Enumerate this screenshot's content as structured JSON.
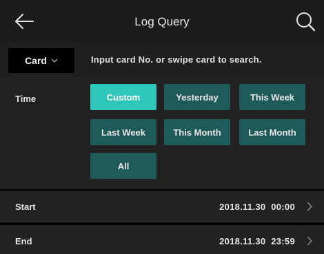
{
  "header": {
    "title": "Log Query",
    "back_icon": "arrow-left-icon",
    "search_icon": "search-icon"
  },
  "search": {
    "type_selected": "Card",
    "hint": "Input card No. or swipe card to search."
  },
  "time": {
    "label": "Time",
    "options": [
      "Custom",
      "Yesterday",
      "This Week",
      "Last Week",
      "This Month",
      "Last Month",
      "All"
    ],
    "selected": "Custom",
    "accent_color": "#2ec7bb",
    "button_color": "#1e5a58"
  },
  "start": {
    "label": "Start",
    "value": "2018.11.30  00:00"
  },
  "end": {
    "label": "End",
    "value": "2018.11.30  23:59"
  }
}
